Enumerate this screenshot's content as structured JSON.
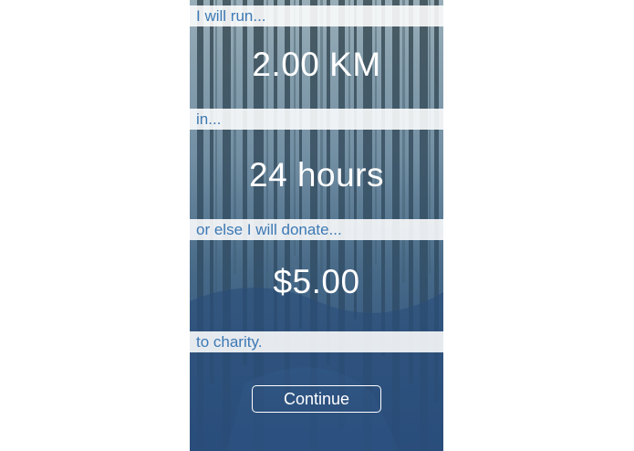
{
  "goal": {
    "distance_prompt": "I will run...",
    "distance_value": "2.00 KM",
    "time_prompt": "in...",
    "time_value": "24 hours",
    "penalty_prompt": "or else I will donate...",
    "penalty_value": "$5.00",
    "recipient_text": "to charity."
  },
  "actions": {
    "continue_label": "Continue"
  },
  "colors": {
    "prompt_text": "#3d79b4",
    "band_background": "#ffffff",
    "value_text": "#ffffff"
  }
}
